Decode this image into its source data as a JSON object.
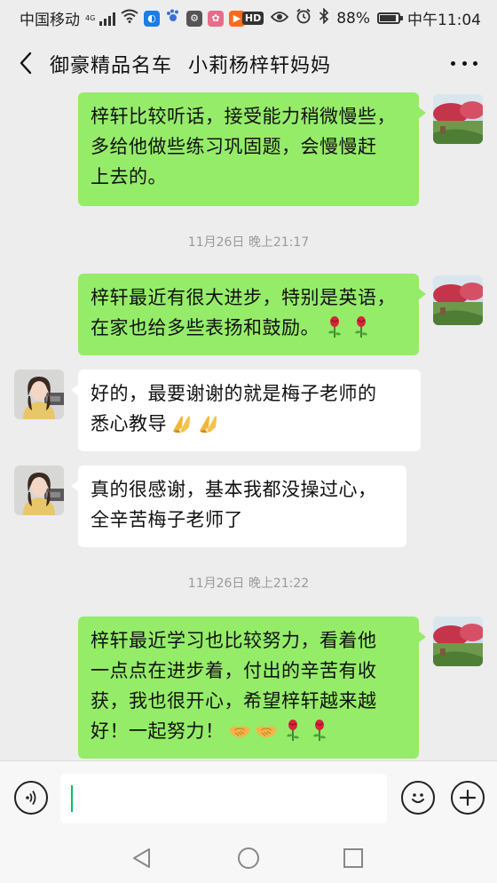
{
  "status_bar": {
    "carrier": "中国移动",
    "network": "4G",
    "battery": "88%",
    "battery_level": 0.88,
    "time": "中午11:04",
    "hd_label": "HD"
  },
  "header": {
    "title_part1": "御豪精品名车",
    "title_part2": "小莉杨梓轩妈妈"
  },
  "messages": [
    {
      "direction": "out",
      "lines": [
        "梓轩比较听话，接受能力稍微慢些，",
        "多给他做些练习巩固题，会慢慢赶",
        "上去的。"
      ]
    },
    {
      "type": "timestamp",
      "text": "11月26日 晚上21:17"
    },
    {
      "direction": "out",
      "lines": [
        "梓轩最近有很大进步，特别是英语，",
        "在家也给多些表扬和鼓励。"
      ],
      "emojis": [
        "rose-emoji",
        "rose-emoji"
      ]
    },
    {
      "direction": "in",
      "lines": [
        "好的，最要谢谢的就是梅子老师的",
        "悉心教导"
      ],
      "emojis": [
        "folded-hands-emoji",
        "folded-hands-emoji"
      ]
    },
    {
      "direction": "in",
      "lines": [
        "真的很感谢，基本我都没操过心，",
        "全辛苦梅子老师了"
      ]
    },
    {
      "type": "timestamp",
      "text": "11月26日 晚上21:22"
    },
    {
      "direction": "out",
      "lines": [
        "梓轩最近学习也比较努力，看着他",
        "一点点在进步着，付出的辛苦有收",
        "获，我也很开心，希望梓轩越来越",
        "好！一起努力！"
      ],
      "emojis": [
        "handshake-emoji",
        "handshake-emoji",
        "rose-emoji",
        "rose-emoji"
      ]
    }
  ],
  "input": {
    "placeholder": ""
  },
  "colors": {
    "background": "#ededed",
    "outgoing_bubble": "#95ec69",
    "incoming_bubble": "#ffffff",
    "accent": "#07c160"
  }
}
